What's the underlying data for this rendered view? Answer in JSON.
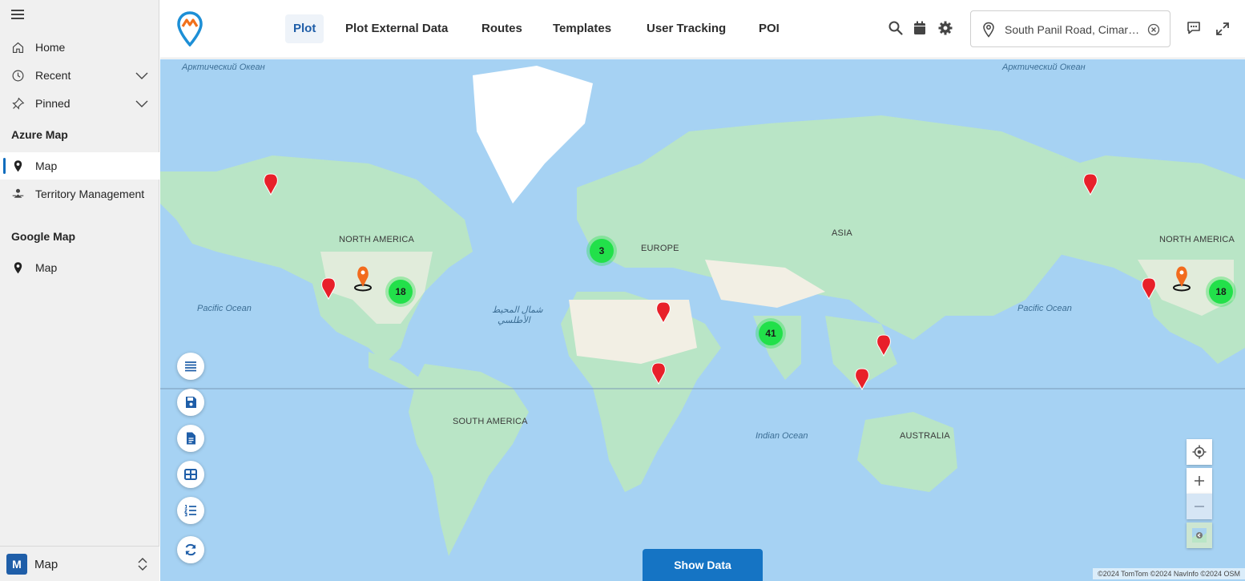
{
  "sidebar": {
    "items": [
      {
        "label": "Home"
      },
      {
        "label": "Recent"
      },
      {
        "label": "Pinned"
      }
    ],
    "groups": [
      {
        "title": "Azure Map",
        "items": [
          {
            "label": "Map"
          },
          {
            "label": "Territory Management"
          }
        ]
      },
      {
        "title": "Google Map",
        "items": [
          {
            "label": "Map"
          }
        ]
      }
    ],
    "area": {
      "badge": "M",
      "label": "Map"
    }
  },
  "header": {
    "tabs": [
      {
        "label": "Plot"
      },
      {
        "label": "Plot External Data"
      },
      {
        "label": "Routes"
      },
      {
        "label": "Templates"
      },
      {
        "label": "User Tracking"
      },
      {
        "label": "POI"
      }
    ],
    "location_value": "South Panil Road, Cimarron, Kansas"
  },
  "map": {
    "ocean_labels": {
      "arctic_left": "Арктический Океан",
      "arctic_right": "Арктический Океан",
      "pacific_left": "Pacific Ocean",
      "pacific_right": "Pacific Ocean",
      "atlantic_ar_1": "شمال المحيط",
      "atlantic_ar_2": "الأطلسي",
      "indian": "Indian Ocean"
    },
    "continent_labels": {
      "north_america_left": "NORTH AMERICA",
      "north_america_right": "NORTH AMERICA",
      "europe": "EUROPE",
      "asia": "ASIA",
      "south_america": "SOUTH AMERICA",
      "australia": "AUSTRALIA"
    },
    "clusters": {
      "europe": "3",
      "usa_left": "18",
      "india": "41",
      "usa_right": "18"
    },
    "show_data_label": "Show Data",
    "copyright": "©2024 TomTom ©2024 NavInfo ©2024 OSM"
  },
  "colors": {
    "accent": "#1574c4",
    "cluster": "#22e04a",
    "marker_red": "#e8202a",
    "marker_orange": "#f26b1d",
    "ocean": "#a6d2f3",
    "land": "#b6e3c4"
  }
}
